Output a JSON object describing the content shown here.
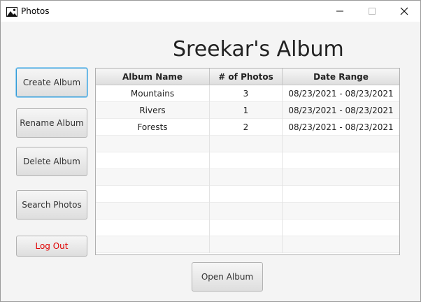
{
  "window": {
    "title": "Photos",
    "icon": "image-icon",
    "controls": [
      "minimize-icon",
      "maximize-icon",
      "close-icon"
    ]
  },
  "main": {
    "heading": "Sreekar's Album"
  },
  "sidebar": {
    "create_label": "Create Album",
    "rename_label": "Rename Album",
    "delete_label": "Delete Album",
    "search_label": "Search Photos",
    "logout_label": "Log Out"
  },
  "table": {
    "columns": [
      "Album Name",
      "# of Photos",
      "Date Range"
    ],
    "rows": [
      [
        "Mountains",
        "3",
        "08/23/2021 - 08/23/2021"
      ],
      [
        "Rivers",
        "1",
        "08/23/2021 - 08/23/2021"
      ],
      [
        "Forests",
        "2",
        "08/23/2021 - 08/23/2021"
      ]
    ]
  },
  "footer": {
    "open_label": "Open Album"
  },
  "colors": {
    "focus_border": "#2f9bd8",
    "logout_text": "#e00000",
    "window_bg": "#f4f4f4"
  }
}
